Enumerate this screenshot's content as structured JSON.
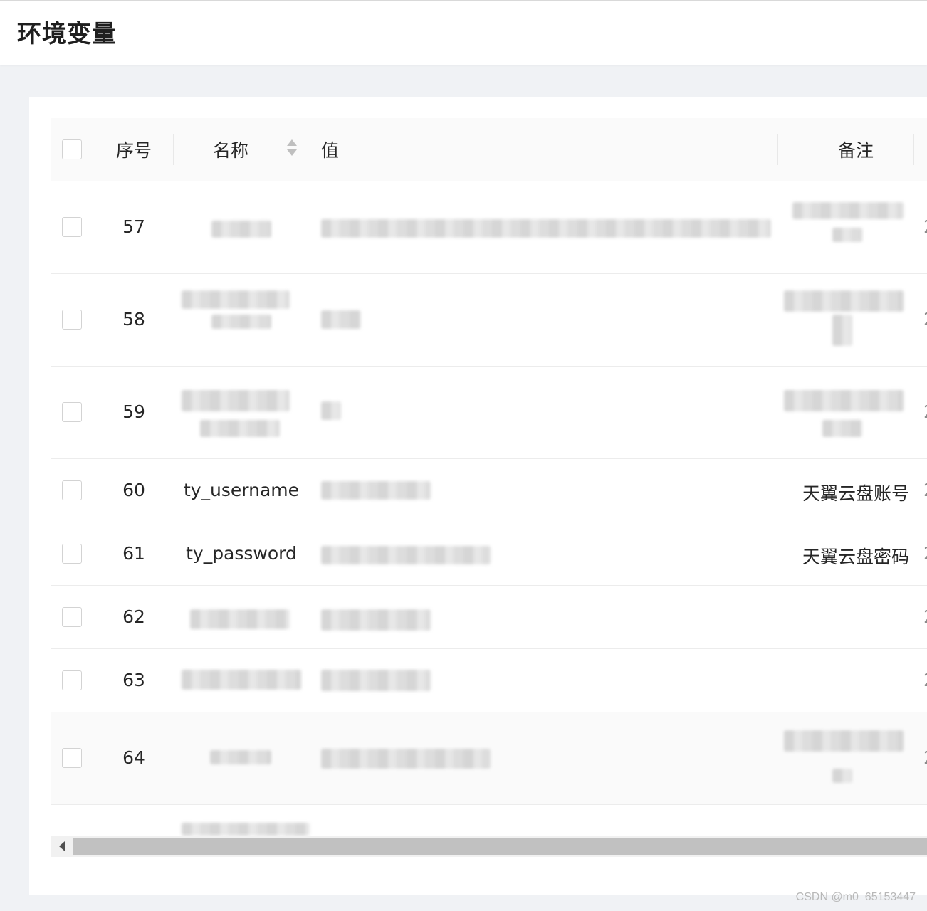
{
  "page": {
    "title": "环境变量"
  },
  "table": {
    "columns": {
      "index": "序号",
      "name": "名称",
      "value": "值",
      "note": "备注"
    },
    "rows": [
      {
        "index": "57",
        "name": "",
        "value": "",
        "note": "",
        "edge": "2"
      },
      {
        "index": "58",
        "name": "",
        "value": "",
        "note": "",
        "edge": "2"
      },
      {
        "index": "59",
        "name": "",
        "value": "",
        "note": "",
        "edge": "2"
      },
      {
        "index": "60",
        "name": "ty_username",
        "value": "",
        "note": "天翼云盘账号",
        "edge": "2"
      },
      {
        "index": "61",
        "name": "ty_password",
        "value": "",
        "note": "天翼云盘密码",
        "edge": "2"
      },
      {
        "index": "62",
        "name": "",
        "value": "",
        "note": "",
        "edge": "2"
      },
      {
        "index": "63",
        "name": "",
        "value": "",
        "note": "",
        "edge": "2"
      },
      {
        "index": "64",
        "name": "",
        "value": "",
        "note": "",
        "edge": "2"
      }
    ]
  },
  "watermark": "CSDN @m0_65153447"
}
